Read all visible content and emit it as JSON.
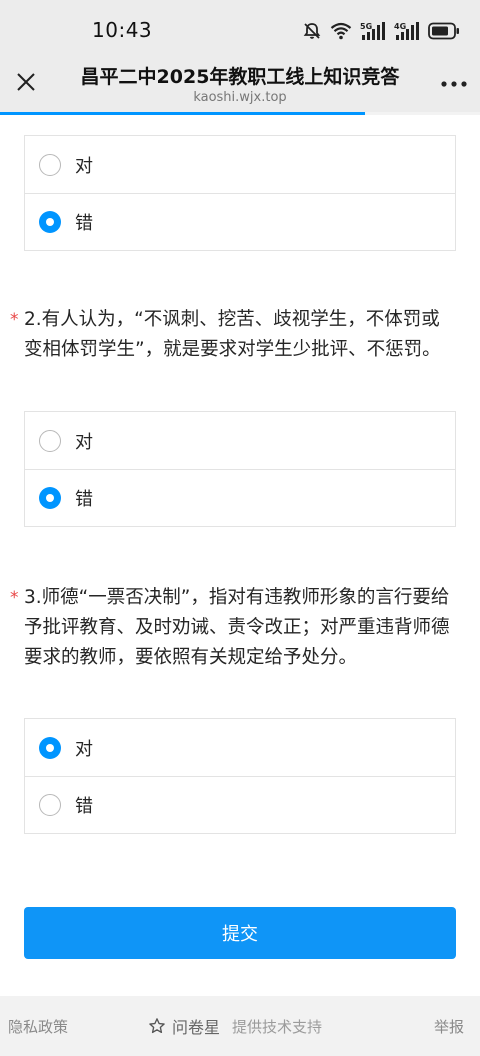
{
  "status_bar": {
    "time": "10:43",
    "icons": [
      "mute-icon",
      "wifi-icon",
      "signal-5g-icon",
      "signal-4g-icon",
      "battery-icon"
    ],
    "network_5g": "5G",
    "network_4g": "4G"
  },
  "nav": {
    "title": "昌平二中2025年教职工线上知识竞答",
    "domain": "kaoshi.wjx.top"
  },
  "progress": {
    "fraction": 0.76
  },
  "questions": [
    {
      "options": [
        {
          "label": "对",
          "selected": false
        },
        {
          "label": "错",
          "selected": true
        }
      ]
    },
    {
      "title": "2.有人认为，“不讽刺、挖苦、歧视学生，不体罚或变相体罚学生”，就是要求对学生少批评、不惩罚。",
      "options": [
        {
          "label": "对",
          "selected": false
        },
        {
          "label": "错",
          "selected": true
        }
      ]
    },
    {
      "title": "3.师德“一票否决制”，指对有违教师形象的言行要给予批评教育、及时劝诫、责令改正；对严重违背师德要求的教师，要依照有关规定给予处分。",
      "options": [
        {
          "label": "对",
          "selected": true
        },
        {
          "label": "错",
          "selected": false
        }
      ]
    }
  ],
  "required_mark": "*",
  "submit_label": "提交",
  "footer": {
    "privacy": "隐私政策",
    "brand": "问卷星",
    "support": "提供技术支持",
    "report": "举报"
  },
  "colors": {
    "accent": "#0095ff",
    "button": "#0f95f7",
    "required": "#e84747"
  }
}
